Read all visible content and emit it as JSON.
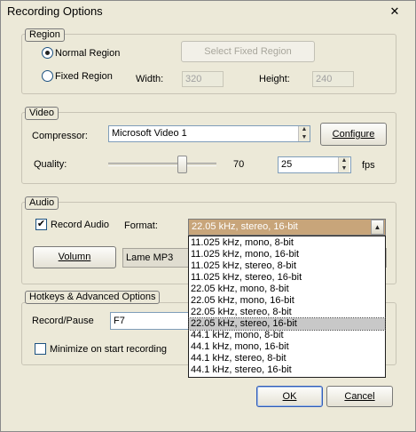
{
  "window": {
    "title": "Recording Options",
    "close_label": "✕"
  },
  "region": {
    "legend": "Region",
    "normal_label": "Normal Region",
    "fixed_label": "Fixed Region",
    "select_fixed_label": "Select Fixed Region",
    "width_label": "Width:",
    "width_value": "320",
    "height_label": "Height:",
    "height_value": "240"
  },
  "video": {
    "legend": "Video",
    "compressor_label": "Compressor:",
    "compressor_value": "Microsoft Video 1",
    "configure_label": "Configure",
    "quality_label": "Quality:",
    "quality_value": "70",
    "quality_level": 70,
    "fps_value": "25",
    "fps_label": "fps"
  },
  "audio": {
    "legend": "Audio",
    "record_audio_label": "Record Audio",
    "format_label": "Format:",
    "format_value": "22.05 kHz, stereo, 16-bit",
    "volumn_label": "Volumn",
    "codec_value": "Lame MP3"
  },
  "format_options": [
    "11.025 kHz, mono, 8-bit",
    "11.025 kHz, mono, 16-bit",
    "11.025 kHz, stereo, 8-bit",
    "11.025 kHz, stereo, 16-bit",
    "22.05 kHz, mono, 8-bit",
    "22.05 kHz, mono, 16-bit",
    "22.05 kHz, stereo, 8-bit",
    "22.05 kHz, stereo, 16-bit",
    "44.1 kHz, mono, 8-bit",
    "44.1 kHz, mono, 16-bit",
    "44.1 kHz, stereo, 8-bit",
    "44.1 kHz, stereo, 16-bit"
  ],
  "hotkeys": {
    "legend": "Hotkeys & Advanced Options",
    "record_pause_label": "Record/Pause",
    "record_pause_value": "F7",
    "minimize_label": "Minimize on start recording"
  },
  "buttons": {
    "ok_label": "OK",
    "cancel_label": "Cancel"
  },
  "icons": {
    "close": "close-icon",
    "spin_up": "spin-up-icon",
    "spin_down": "spin-down-icon",
    "dropdown": "chevron-down-icon"
  },
  "colors": {
    "selected_format_bg": "#c8a57a",
    "selection_highlight": "#c8c8c8"
  }
}
